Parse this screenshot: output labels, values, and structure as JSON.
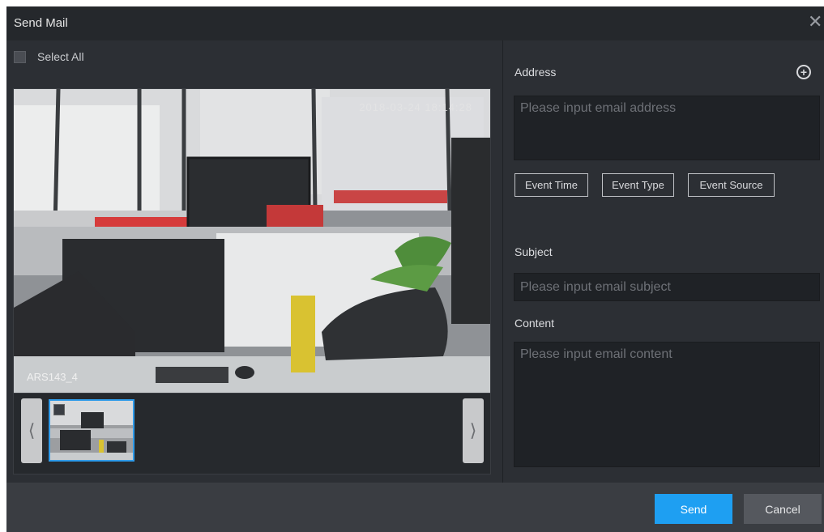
{
  "dialog": {
    "title": "Send Mail"
  },
  "left": {
    "select_all_label": "Select All",
    "image": {
      "timestamp": "2018-03-24 18:14:28",
      "camera_label": "ARS143_4"
    }
  },
  "right": {
    "address_label": "Address",
    "address_placeholder": "Please input email address",
    "tags": [
      "Event Time",
      "Event Type",
      "Event Source"
    ],
    "subject_label": "Subject",
    "subject_placeholder": "Please input email subject",
    "content_label": "Content",
    "content_placeholder": "Please input email content"
  },
  "footer": {
    "send_label": "Send",
    "cancel_label": "Cancel"
  },
  "icons": {
    "close": "close-icon",
    "add": "add-circle-icon",
    "prev": "chevron-left-icon",
    "next": "chevron-right-icon"
  },
  "colors": {
    "accent": "#1e9ff2",
    "background": "#2c2f34",
    "title_bar": "#25282c"
  }
}
